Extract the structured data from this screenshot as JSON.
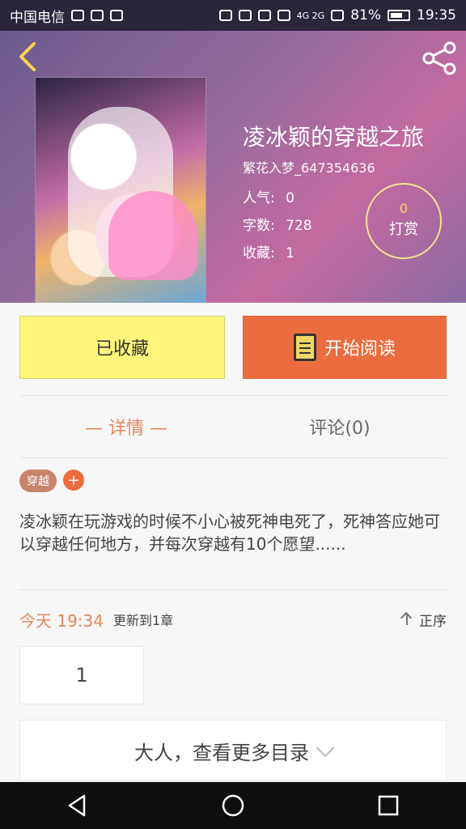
{
  "status_bar": {
    "carrier": "中国电信",
    "network": "4G 2G",
    "battery_percent": "81%",
    "time": "19:35"
  },
  "header": {
    "title": "凌冰颖的穿越之旅",
    "author": "繁花入梦_647354636",
    "popularity_label": "人气:",
    "popularity_value": "0",
    "words_label": "字数:",
    "words_value": "728",
    "favorites_label": "收藏:",
    "favorites_value": "1",
    "tip_count": "0",
    "tip_label": "打赏",
    "back_icon": "chevron-left-icon",
    "share_icon": "share-icon"
  },
  "actions": {
    "favorited_label": "已收藏",
    "read_label": "开始阅读",
    "read_icon": "book-icon"
  },
  "tabs": {
    "details": "—  详情  —",
    "comments": "评论(0)"
  },
  "tags": {
    "items": [
      "穿越"
    ],
    "add_label": "+"
  },
  "description": "凌冰颖在玩游戏的时候不小心被死神电死了，死神答应她可以穿越任何地方，并每次穿越有10个愿望......",
  "update": {
    "time": "今天  19:34",
    "text": "更新到1章",
    "order_label": "正序"
  },
  "chapter_box": "1",
  "more_catalog": "大人，查看更多目录"
}
